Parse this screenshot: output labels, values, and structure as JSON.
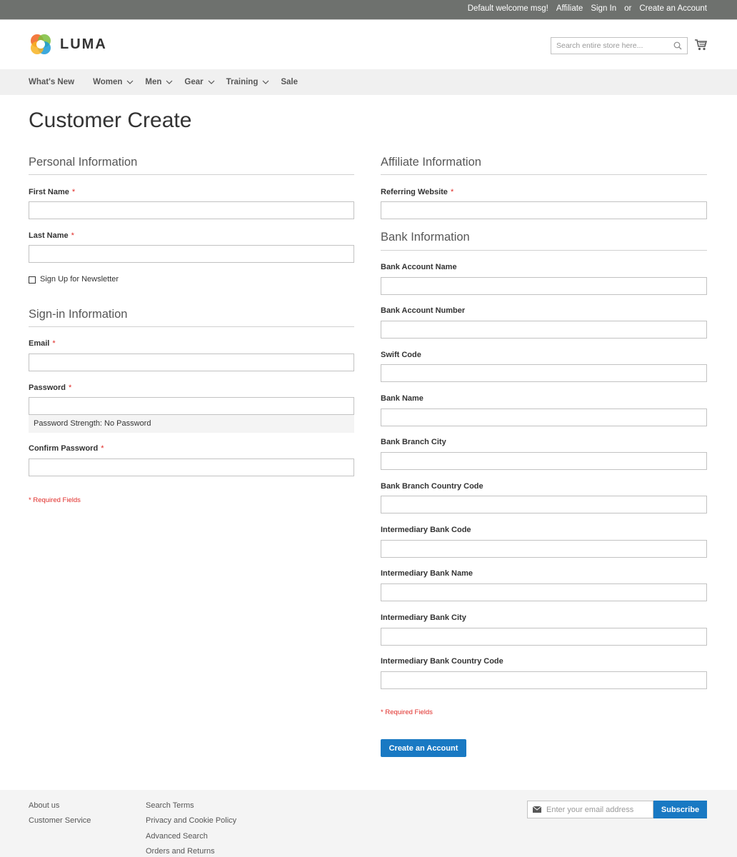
{
  "topbar": {
    "welcome": "Default welcome msg!",
    "affiliate": "Affiliate",
    "sign_in": "Sign In",
    "or": "or",
    "create_account": "Create an Account"
  },
  "header": {
    "logo_text": "LUMA",
    "search_placeholder": "Search entire store here...",
    "icons": [
      "logo-icon",
      "search-icon",
      "cart-icon"
    ]
  },
  "nav": {
    "items": [
      "What's New",
      "Women",
      "Men",
      "Gear",
      "Training",
      "Sale"
    ]
  },
  "page": {
    "title": "Customer Create"
  },
  "personal": {
    "legend": "Personal Information",
    "first_name": "First Name",
    "last_name": "Last Name",
    "newsletter": "Sign Up for Newsletter"
  },
  "signin": {
    "legend": "Sign-in Information",
    "email": "Email",
    "password": "Password",
    "strength": "Password Strength: No Password",
    "confirm": "Confirm Password"
  },
  "required_mark": "*",
  "required_note": "* Required Fields",
  "affiliate": {
    "legend": "Affiliate Information",
    "referring_website": "Referring Website"
  },
  "bank": {
    "legend": "Bank Information",
    "fields": [
      "Bank Account Name",
      "Bank Account Number",
      "Swift Code",
      "Bank Name",
      "Bank Branch City",
      "Bank Branch Country Code",
      "Intermediary Bank Code",
      "Intermediary Bank Name",
      "Intermediary Bank City",
      "Intermediary Bank Country Code"
    ]
  },
  "submit_label": "Create an Account",
  "footer": {
    "col1": [
      "About us",
      "Customer Service"
    ],
    "col2": [
      "Search Terms",
      "Privacy and Cookie Policy",
      "Advanced Search",
      "Orders and Returns"
    ],
    "newsletter_placeholder": "Enter your email address",
    "subscribe_label": "Subscribe"
  },
  "colors": {
    "accent": "#1979c3",
    "required": "#e02b27",
    "topbar": "#6e716e",
    "nav_bg": "#f0f0f0"
  }
}
